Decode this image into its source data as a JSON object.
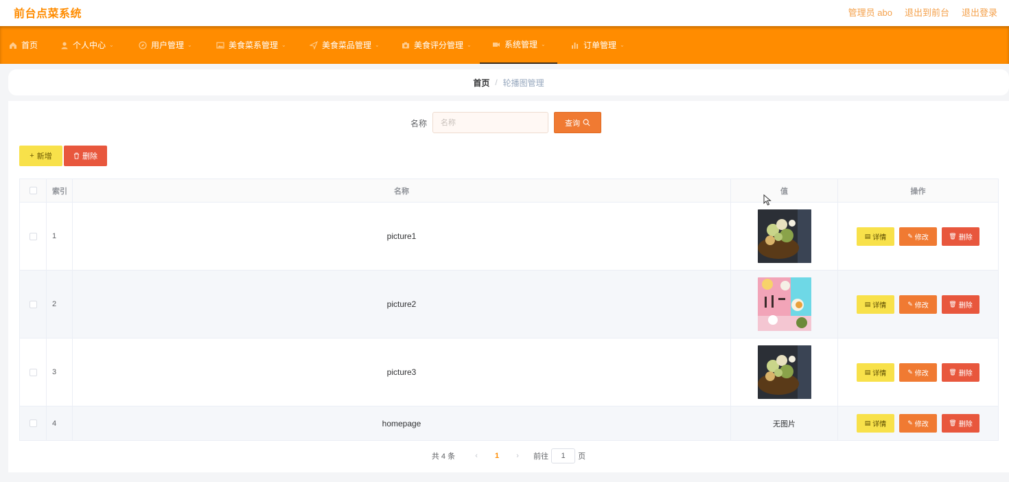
{
  "app": {
    "title": "前台点菜系统",
    "top_links": [
      "管理员 abo",
      "退出到前台",
      "退出登录"
    ]
  },
  "nav": {
    "items": [
      {
        "label": "首页",
        "icon": "home-icon",
        "has_dropdown": false
      },
      {
        "label": "个人中心",
        "icon": "user-icon",
        "has_dropdown": true
      },
      {
        "label": "用户管理",
        "icon": "compass-icon",
        "has_dropdown": true
      },
      {
        "label": "美食菜系管理",
        "icon": "picture-icon",
        "has_dropdown": true
      },
      {
        "label": "美食菜品管理",
        "icon": "send-icon",
        "has_dropdown": true
      },
      {
        "label": "美食评分管理",
        "icon": "camera-icon",
        "has_dropdown": true
      },
      {
        "label": "系统管理",
        "icon": "video-icon",
        "has_dropdown": true,
        "active": true
      },
      {
        "label": "订单管理",
        "icon": "bar-chart-icon",
        "has_dropdown": true
      }
    ]
  },
  "breadcrumb": {
    "home": "首页",
    "separator": "/",
    "current": "轮播图管理"
  },
  "search": {
    "label": "名称",
    "placeholder": "名称",
    "button_label": "查询"
  },
  "actions": {
    "add_label": "新增",
    "delete_label": "删除"
  },
  "table": {
    "headers": {
      "index": "索引",
      "name": "名称",
      "value": "值",
      "ops": "操作"
    },
    "rows": [
      {
        "index": "1",
        "name": "picture1",
        "value_type": "image",
        "image": "food-salad-image"
      },
      {
        "index": "2",
        "name": "picture2",
        "value_type": "image",
        "image": "food-japanese-image"
      },
      {
        "index": "3",
        "name": "picture3",
        "value_type": "image",
        "image": "food-salad-image"
      },
      {
        "index": "4",
        "name": "homepage",
        "value_type": "text",
        "value": "无图片"
      }
    ],
    "op_labels": {
      "detail": "详情",
      "edit": "修改",
      "delete": "删除"
    }
  },
  "pagination": {
    "total_text": "共 4 条",
    "current_page": "1",
    "goto_label": "前往",
    "goto_value": "1",
    "page_suffix": "页"
  },
  "colors": {
    "brand_orange": "#ff8c00",
    "button_yellow": "#f8e14a",
    "button_orange": "#f07a32",
    "button_red": "#e8573d"
  }
}
